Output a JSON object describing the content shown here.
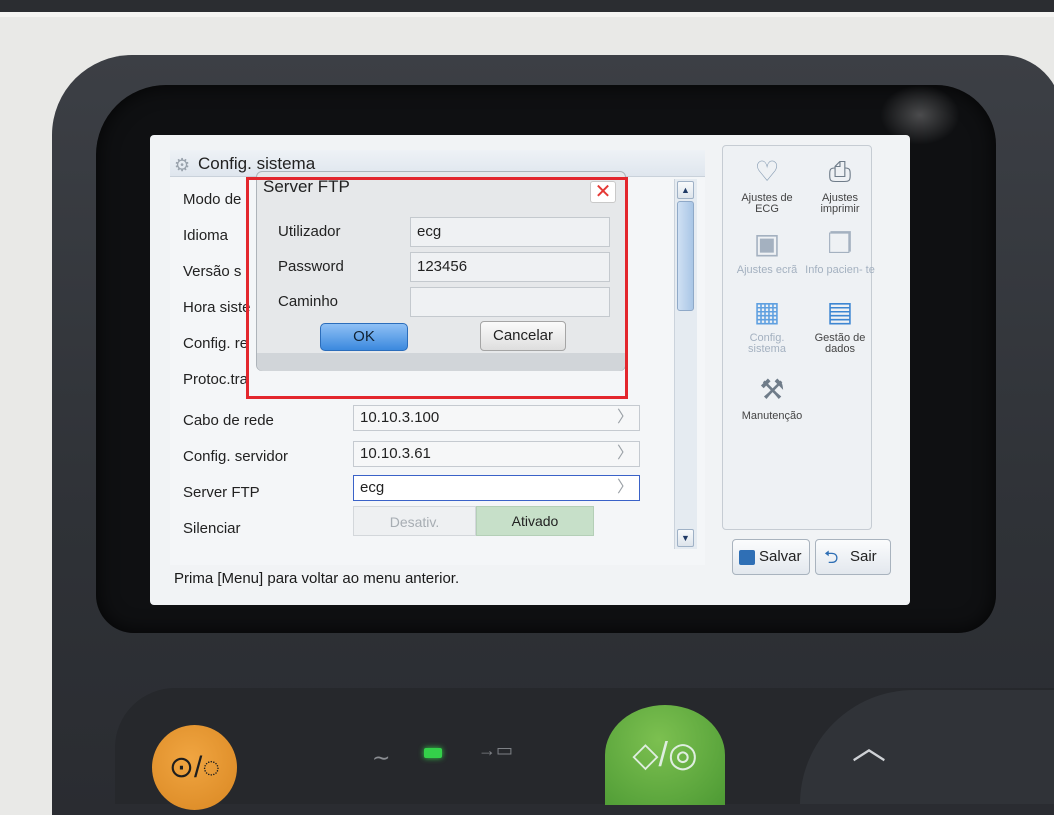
{
  "panel": {
    "title": "Config. sistema",
    "rows": [
      {
        "label": "Modo de"
      },
      {
        "label": "Idioma"
      },
      {
        "label": "Versão s"
      },
      {
        "label": "Hora siste"
      },
      {
        "label": "Config. re"
      },
      {
        "label": "Protoc.tra"
      },
      {
        "label": "Cabo de rede",
        "value": "10.10.3.100"
      },
      {
        "label": "Config. servidor",
        "value": "10.10.3.61"
      },
      {
        "label": "Server FTP",
        "value": "ecg"
      },
      {
        "label": "Silenciar"
      }
    ],
    "toggle": {
      "off": "Desativ.",
      "on": "Ativado"
    },
    "status": "Prima [Menu] para voltar ao menu anterior."
  },
  "dialog": {
    "title": "Server FTP",
    "close": "✕",
    "fields": [
      {
        "label": "Utilizador",
        "value": "ecg"
      },
      {
        "label": "Password",
        "value": "123456"
      },
      {
        "label": "Caminho",
        "value": ""
      }
    ],
    "ok": "OK",
    "cancel": "Cancelar"
  },
  "sidebar": {
    "items": [
      {
        "label": "Ajustes de ECG",
        "icon": "heart-ecg-icon"
      },
      {
        "label": "Ajustes imprimir",
        "icon": "printer-icon"
      },
      {
        "label": "Ajustes ecrã",
        "icon": "screen-icon"
      },
      {
        "label": "Info pacien- te",
        "icon": "patient-info-icon"
      },
      {
        "label": "Config. sistema",
        "icon": "system-config-icon"
      },
      {
        "label": "Gestão de dados",
        "icon": "data-management-icon"
      },
      {
        "label": "Manutenção",
        "icon": "maintenance-icon"
      }
    ],
    "save": "Salvar",
    "exit": "Sair"
  },
  "colors": {
    "highlight": "#e3262d",
    "accent": "#3b89de",
    "toggle_on": "#c7e0c9"
  }
}
